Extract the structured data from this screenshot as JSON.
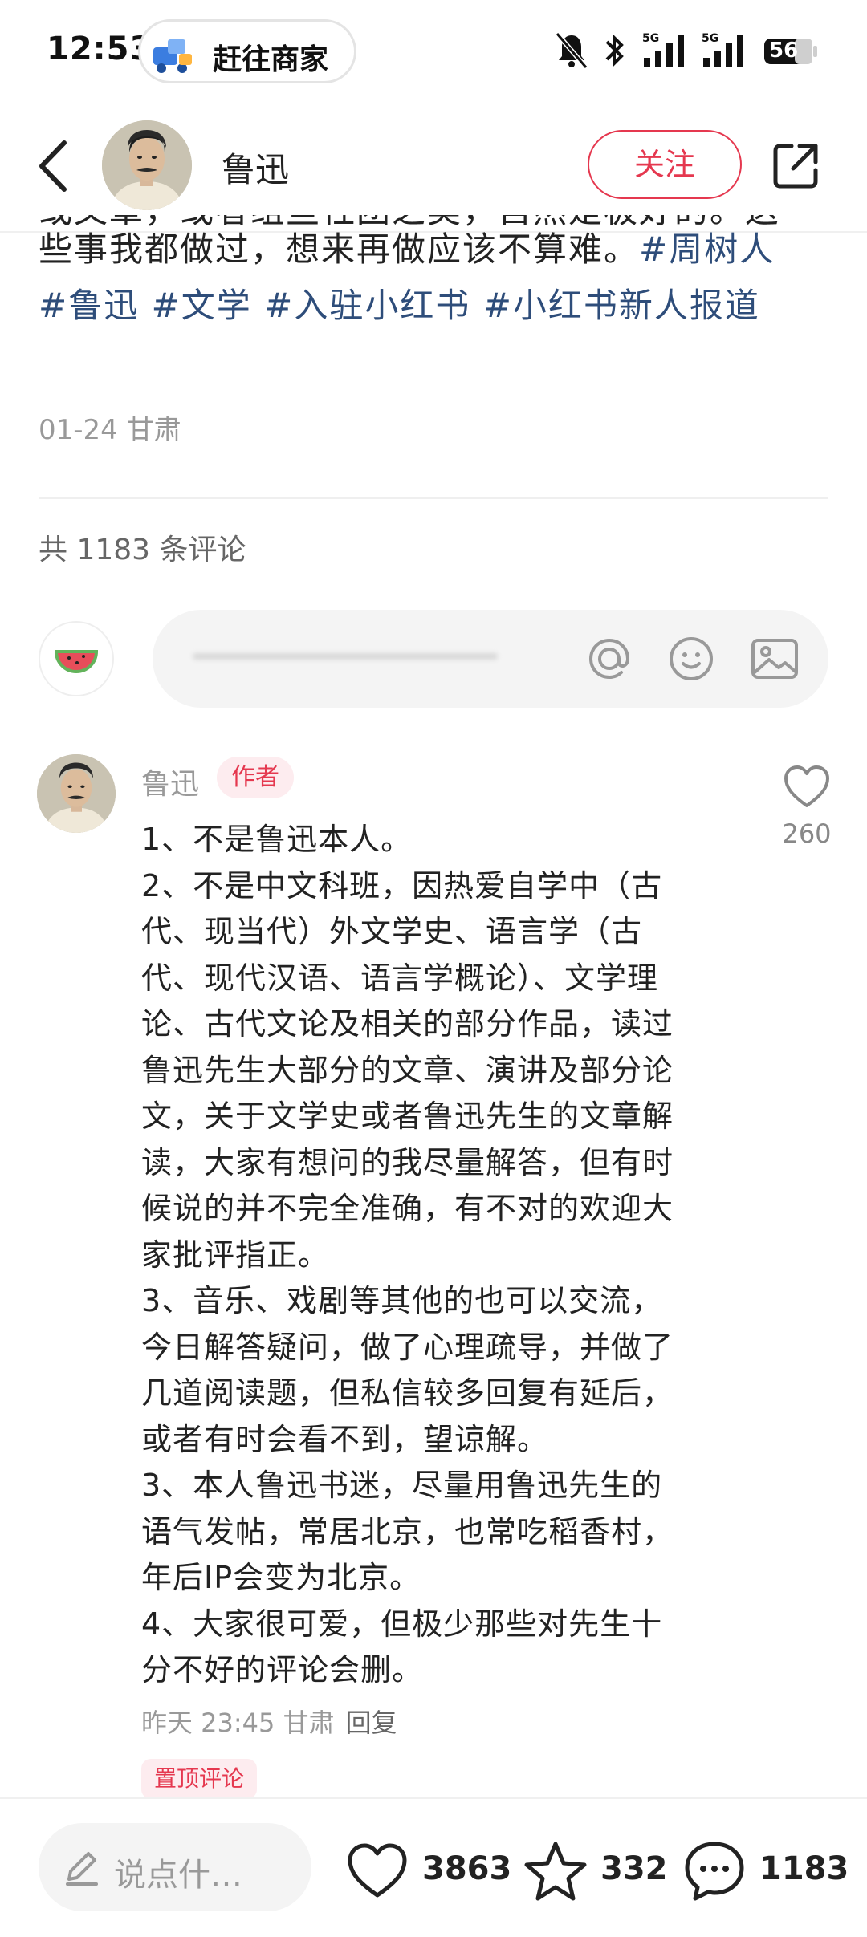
{
  "status_bar": {
    "time": "12:53",
    "pill_text": "赶往商家",
    "battery": "56"
  },
  "header": {
    "author_name": "鲁迅",
    "follow_label": "关注"
  },
  "post": {
    "text_cut_line": "或文章，或者组些社团之类，自然是极好的。这",
    "text_line2": "些事我都做过，想来再做应该不算难。",
    "tags": [
      "#周树人",
      "#鲁迅",
      "#文学",
      "#入驻小红书",
      "#小红书新人报道"
    ],
    "meta": "01-24 甘肃"
  },
  "comments_header": {
    "count_text": "共 1183 条评论"
  },
  "comment": {
    "name": "鲁迅",
    "badge": "作者",
    "likes": "260",
    "lines": [
      "1、不是鲁迅本人。",
      "2、不是中文科班，因热爱自学中（古",
      "代、现当代）外文学史、语言学（古",
      "代、现代汉语、语言学概论）、文学理",
      "论、古代文论及相关的部分作品，读过",
      "鲁迅先生大部分的文章、演讲及部分论",
      "文，关于文学史或者鲁迅先生的文章解",
      "读，大家有想问的我尽量解答，但有时",
      "候说的并不完全准确，有不对的欢迎大",
      "家批评指正。",
      "3、音乐、戏剧等其他的也可以交流，",
      "今日解答疑问，做了心理疏导，并做了",
      "几道阅读题，但私信较多回复有延后，",
      "或者有时会看不到，望谅解。",
      "3、本人鲁迅书迷，尽量用鲁迅先生的",
      "语气发帖，常居北京，也常吃稻香村，",
      "年后IP会变为北京。",
      "4、大家很可爱，但极少那些对先生十",
      "分不好的评论会删。"
    ],
    "meta": "昨天 23:45 甘肃",
    "reply": "回复",
    "pinned": "置顶评论"
  },
  "bottom_bar": {
    "placeholder": "说点什…",
    "likes": "3863",
    "stars": "332",
    "comments": "1183"
  },
  "colors": {
    "accent": "#e5384f",
    "tag": "#2e4d7a"
  },
  "icons": [
    "back-icon",
    "share-icon",
    "at-icon",
    "emoji-icon",
    "image-icon",
    "heart-icon",
    "star-icon",
    "comment-icon",
    "pencil-icon",
    "watermelon-icon"
  ]
}
